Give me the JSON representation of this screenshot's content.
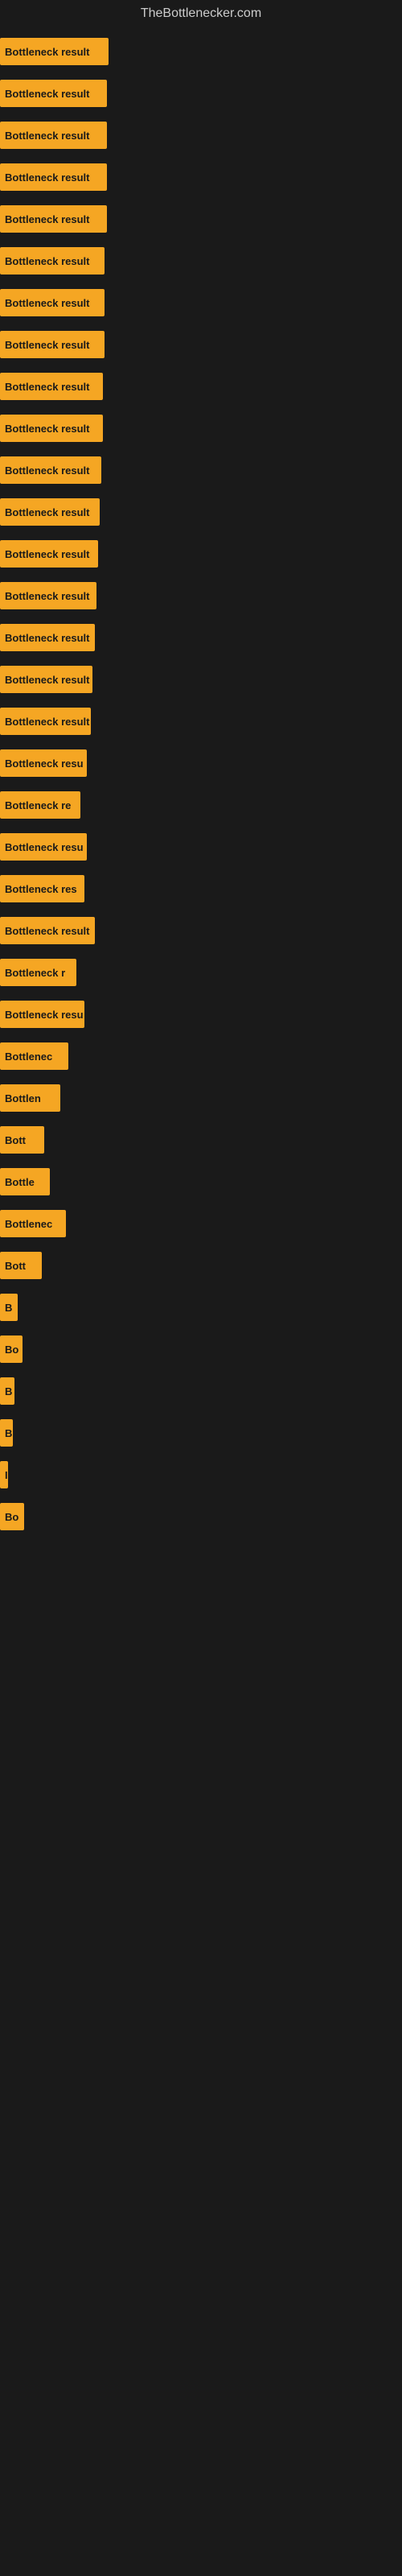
{
  "site": {
    "title": "TheBottlenecker.com"
  },
  "bars": [
    {
      "label": "Bottleneck result",
      "width": 135
    },
    {
      "label": "Bottleneck result",
      "width": 133
    },
    {
      "label": "Bottleneck result",
      "width": 133
    },
    {
      "label": "Bottleneck result",
      "width": 133
    },
    {
      "label": "Bottleneck result",
      "width": 133
    },
    {
      "label": "Bottleneck result",
      "width": 130
    },
    {
      "label": "Bottleneck result",
      "width": 130
    },
    {
      "label": "Bottleneck result",
      "width": 130
    },
    {
      "label": "Bottleneck result",
      "width": 128
    },
    {
      "label": "Bottleneck result",
      "width": 128
    },
    {
      "label": "Bottleneck result",
      "width": 126
    },
    {
      "label": "Bottleneck result",
      "width": 124
    },
    {
      "label": "Bottleneck result",
      "width": 122
    },
    {
      "label": "Bottleneck result",
      "width": 120
    },
    {
      "label": "Bottleneck result",
      "width": 118
    },
    {
      "label": "Bottleneck result",
      "width": 115
    },
    {
      "label": "Bottleneck result",
      "width": 113
    },
    {
      "label": "Bottleneck resu",
      "width": 108
    },
    {
      "label": "Bottleneck re",
      "width": 100
    },
    {
      "label": "Bottleneck resu",
      "width": 108
    },
    {
      "label": "Bottleneck res",
      "width": 105
    },
    {
      "label": "Bottleneck result",
      "width": 118
    },
    {
      "label": "Bottleneck r",
      "width": 95
    },
    {
      "label": "Bottleneck resu",
      "width": 105
    },
    {
      "label": "Bottlenec",
      "width": 85
    },
    {
      "label": "Bottlen",
      "width": 75
    },
    {
      "label": "Bott",
      "width": 55
    },
    {
      "label": "Bottle",
      "width": 62
    },
    {
      "label": "Bottlenec",
      "width": 82
    },
    {
      "label": "Bott",
      "width": 52
    },
    {
      "label": "B",
      "width": 22
    },
    {
      "label": "Bo",
      "width": 28
    },
    {
      "label": "B",
      "width": 18
    },
    {
      "label": "B",
      "width": 16
    },
    {
      "label": "I",
      "width": 10
    },
    {
      "label": "Bo",
      "width": 30
    }
  ]
}
